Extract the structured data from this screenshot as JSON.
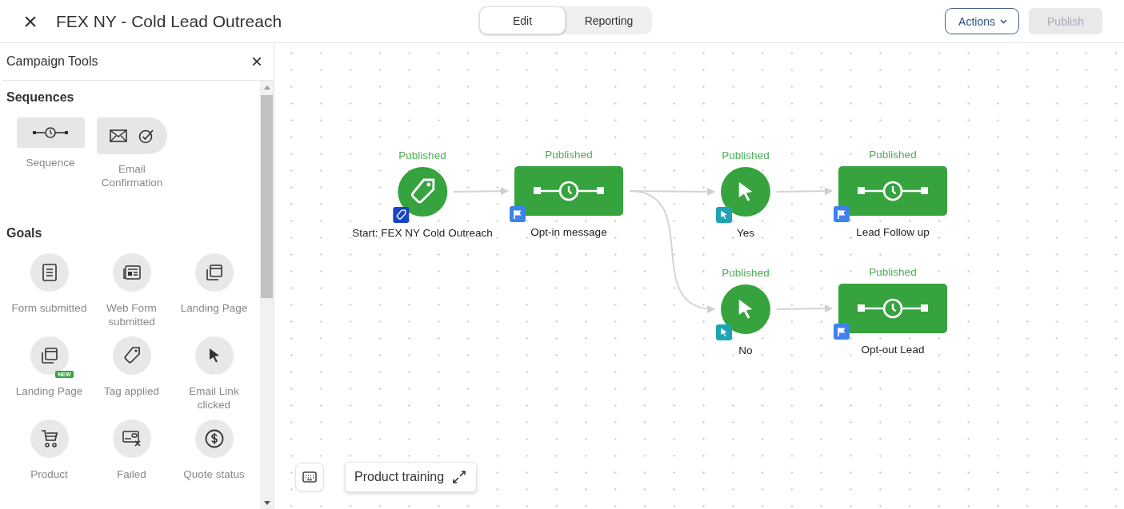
{
  "header": {
    "close": "×",
    "title": "FEX NY - Cold Lead Outreach",
    "tabs": [
      {
        "label": "Edit",
        "selected": true
      },
      {
        "label": "Reporting",
        "selected": false
      }
    ],
    "actions": "Actions",
    "publish": {
      "label": "Publish",
      "disabled": true
    }
  },
  "sidebar": {
    "title": "Campaign Tools",
    "close": "×",
    "sections": [
      {
        "title": "Sequences",
        "kind": "tiles",
        "items": [
          {
            "label": "Sequence"
          },
          {
            "label": "Email Confirmation"
          }
        ]
      },
      {
        "title": "Goals",
        "kind": "circles",
        "items": [
          {
            "label": "Form submitted"
          },
          {
            "label": "Web Form submitted"
          },
          {
            "label": "Landing Page"
          },
          {
            "label": "Landing Page",
            "badge": "NEW"
          },
          {
            "label": "Tag applied"
          },
          {
            "label": "Email Link clicked"
          },
          {
            "label": "Product"
          },
          {
            "label": "Failed"
          },
          {
            "label": "Quote status"
          }
        ]
      }
    ]
  },
  "canvas": {
    "nodes": [
      {
        "status": "Published",
        "name": "Start: FEX NY Cold Outreach",
        "kind": "start"
      },
      {
        "status": "Published",
        "name": "Opt-in message",
        "kind": "sequence"
      },
      {
        "status": "Published",
        "name": "Yes",
        "kind": "goal"
      },
      {
        "status": "Published",
        "name": "Lead Follow up",
        "kind": "sequence"
      },
      {
        "status": "Published",
        "name": "No",
        "kind": "goal"
      },
      {
        "status": "Published",
        "name": "Opt-out Lead",
        "kind": "sequence"
      }
    ],
    "training": "Product training"
  }
}
